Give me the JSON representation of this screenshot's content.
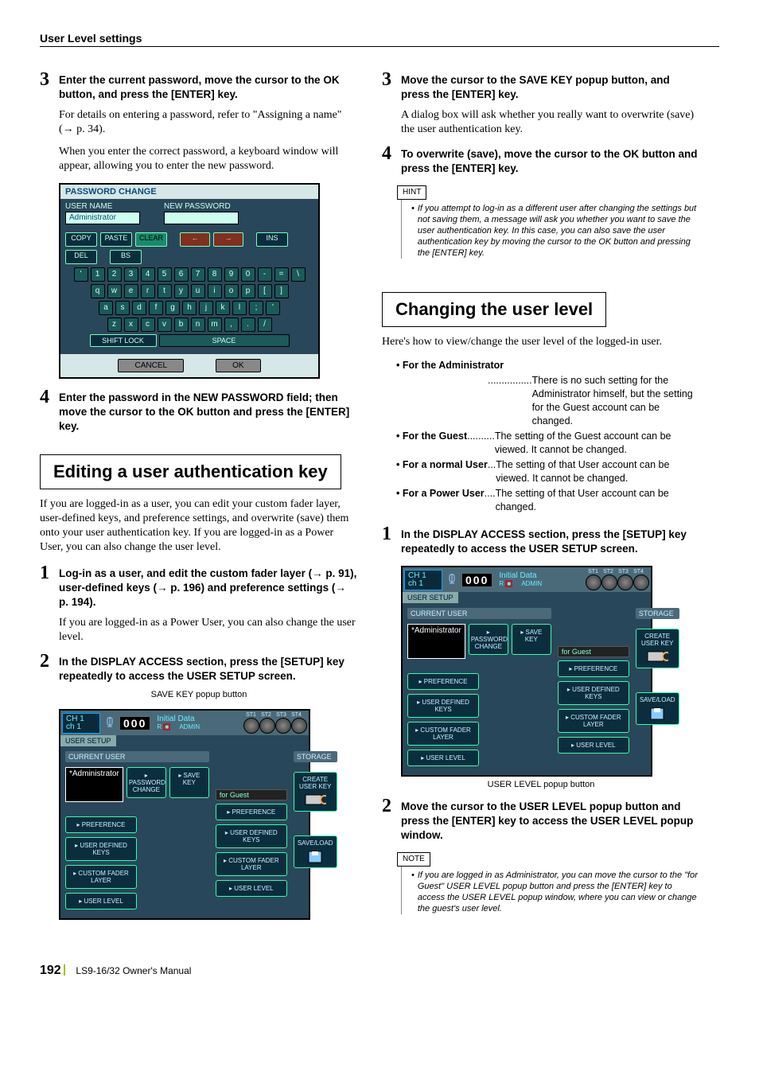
{
  "header": {
    "section_title": "User Level settings"
  },
  "left_col": {
    "step3": {
      "title": "Enter the current password, move the cursor to the OK button, and press the [ENTER] key.",
      "body1": "For details on entering a password, refer to \"Assigning a name\" (→ p. 34).",
      "body2": "When you enter the correct password, a keyboard window will appear, allowing you to enter the new password."
    },
    "keyboard": {
      "title": "PASSWORD CHANGE",
      "username_label": "USER NAME",
      "username_value": "Administrator",
      "newpw_label": "NEW PASSWORD",
      "copy": "COPY",
      "paste": "PASTE",
      "clear": "CLEAR",
      "ins": "INS",
      "del": "DEL",
      "bs": "BS",
      "row1": [
        "'",
        "1",
        "2",
        "3",
        "4",
        "5",
        "6",
        "7",
        "8",
        "9",
        "0",
        "-",
        "=",
        "\\"
      ],
      "row2": [
        "q",
        "w",
        "e",
        "r",
        "t",
        "y",
        "u",
        "i",
        "o",
        "p",
        "[",
        "]"
      ],
      "row3": [
        "a",
        "s",
        "d",
        "f",
        "g",
        "h",
        "j",
        "k",
        "l",
        ";",
        "'"
      ],
      "row4": [
        "z",
        "x",
        "c",
        "v",
        "b",
        "n",
        "m",
        ",",
        ".",
        "/"
      ],
      "shiftlock": "SHIFT LOCK",
      "space": "SPACE",
      "cancel": "CANCEL",
      "ok": "OK"
    },
    "step4": {
      "title": "Enter the password in the NEW PASSWORD field; then move the cursor to the OK button and press the [ENTER] key."
    },
    "section_heading": "Editing a user authentication key",
    "section_intro": "If you are logged-in as a user, you can edit your custom fader layer, user-defined keys, and preference settings, and overwrite (save) them onto your user authentication key. If you are logged-in as a Power User, you can also change the user level.",
    "b_step1": {
      "title": "Log-in as a user, and edit the custom fader layer (→ p. 91), user-defined keys (→ p. 196) and preference settings (→ p. 194).",
      "body": "If you are logged-in as a Power User, you can also change the user level."
    },
    "b_step2": {
      "title": "In the DISPLAY ACCESS section, press the [SETUP] key repeatedly to access the USER SETUP screen."
    },
    "caption_savekey": "SAVE KEY popup button"
  },
  "user_setup": {
    "ch_label1": "CH 1",
    "ch_label2": "ch 1",
    "scene_num": "000",
    "scene_name": "Initial Data",
    "scene_rw": "R",
    "admin": "ADMIN",
    "st_hdr": [
      "ST1",
      "ST2",
      "ST3",
      "ST4"
    ],
    "tab": "USER SETUP",
    "current_user": "CURRENT USER",
    "storage": "STORAGE",
    "userfield": "*Administrator",
    "password_change": "PASSWORD\nCHANGE",
    "save_key": "SAVE\nKEY",
    "create_user_key": "CREATE\nUSER KEY",
    "for_guest": "for Guest",
    "preference": "PREFERENCE",
    "user_defined_keys": "USER DEFINED\nKEYS",
    "custom_fader_layer": "CUSTOM FADER\nLAYER",
    "user_level": "USER LEVEL",
    "save_load": "SAVE/LOAD"
  },
  "right_col": {
    "step3": {
      "title": "Move the cursor to the SAVE KEY popup button, and press the [ENTER] key.",
      "body": "A dialog box will ask whether you really want to overwrite (save) the user authentication key."
    },
    "step4": {
      "title": "To overwrite (save), move the cursor to the OK button and press the [ENTER] key."
    },
    "hint_label": "HINT",
    "hint_text": "If you attempt to log-in as a different user after changing the settings but not saving them, a message will ask you whether you want to save the user authentication key. In this case, you can also save the user authentication key by moving the cursor to the OK button and pressing the [ENTER] key.",
    "section_heading": "Changing the user level",
    "section_intro": "Here's how to view/change the user level of the logged-in user.",
    "bullets": {
      "admin_term": "• For the Administrator",
      "admin_dots": "................",
      "admin_desc": "There is no such setting for the Administrator himself, but the setting for the Guest account can be changed.",
      "guest_term": "• For the Guest",
      "guest_dots": "..........",
      "guest_desc": "The setting of the Guest account can be viewed. It cannot be changed.",
      "normal_term": "• For a normal User",
      "normal_dots": "...",
      "normal_desc": "The setting of that User account can be viewed. It cannot be changed.",
      "power_term": "• For a Power User",
      "power_dots": "....",
      "power_desc": "The setting of that User account can be changed."
    },
    "r_step1": {
      "title": "In the DISPLAY ACCESS section, press the [SETUP] key repeatedly to access the USER SETUP screen."
    },
    "caption_userlevel": "USER LEVEL popup button",
    "r_step2": {
      "title": "Move the cursor to the USER LEVEL popup button and press the [ENTER] key to access the USER LEVEL popup window."
    },
    "note_label": "NOTE",
    "note_text": "If you are logged in as Administrator, you can move the cursor to the \"for Guest\" USER LEVEL popup button and press the [ENTER] key to access the USER LEVEL popup window, where you can view or change the guest's user level."
  },
  "footer": {
    "page": "192",
    "manual": "LS9-16/32  Owner's Manual"
  }
}
